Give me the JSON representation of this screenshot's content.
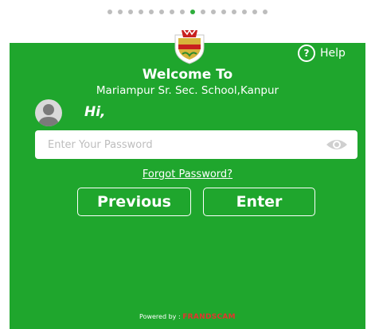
{
  "pager": {
    "count": 16,
    "active_index": 8
  },
  "colors": {
    "brand_green": "#1fa62d",
    "active_dot": "#2eae3c",
    "inactive_dot": "#bdbdbd",
    "brand_red": "#e3342f"
  },
  "help": {
    "label": "Help",
    "icon": "question-circle-icon"
  },
  "welcome": {
    "title": "Welcome To",
    "school": "Mariampur Sr. Sec. School,Kanpur"
  },
  "user": {
    "greeting": "Hi,",
    "avatar_icon": "person-avatar-icon"
  },
  "password": {
    "placeholder": "Enter Your Password",
    "value": "",
    "toggle_icon": "eye-icon"
  },
  "links": {
    "forgot": "Forgot Password?"
  },
  "buttons": {
    "previous": "Previous",
    "enter": "Enter"
  },
  "footer": {
    "powered_by": "Powered by :",
    "brand": "FRANDSCAM"
  }
}
